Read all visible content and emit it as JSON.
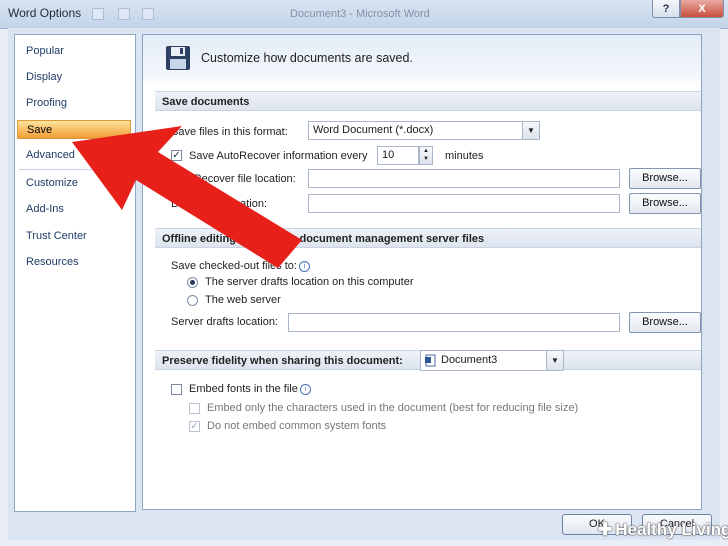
{
  "window": {
    "title": "Word Options",
    "background_title": "Document3 - Microsoft Word",
    "help_label": "?",
    "close_label": "X"
  },
  "sidebar": {
    "items": [
      {
        "label": "Popular"
      },
      {
        "label": "Display"
      },
      {
        "label": "Proofing"
      },
      {
        "label": "Save",
        "selected": true
      },
      {
        "label": "Advanced"
      },
      {
        "label": "Customize"
      },
      {
        "label": "Add-Ins"
      },
      {
        "label": "Trust Center"
      },
      {
        "label": "Resources"
      }
    ]
  },
  "header": {
    "text": "Customize how documents are saved."
  },
  "save_documents": {
    "title": "Save documents",
    "format_label": "Save files in this format:",
    "format_value": "Word Document (*.docx)",
    "autorecover_label": "Save AutoRecover information every",
    "autorecover_checked": true,
    "autorecover_minutes": "10",
    "minutes_label": "minutes",
    "autorecover_location_label": "AutoRecover file location:",
    "autorecover_location_value": "",
    "default_location_label": "Default file location:",
    "default_location_value": "",
    "browse_label": "Browse..."
  },
  "offline": {
    "title": "Offline editing options for document management server files",
    "save_checked_out_label": "Save checked-out files to:",
    "option_server_drafts": "The server drafts location on this computer",
    "option_web_server": "The web server",
    "server_drafts_label": "Server drafts location:",
    "server_drafts_value": "",
    "browse_label": "Browse..."
  },
  "fidelity": {
    "title": "Preserve fidelity when sharing this document:",
    "document_value": "Document3",
    "embed_fonts_label": "Embed fonts in the file",
    "embed_only_label": "Embed only the characters used in the document (best for reducing file size)",
    "no_common_label": "Do not embed common system fonts"
  },
  "footer": {
    "ok_label": "OK",
    "cancel_label": "Cancel"
  },
  "watermark": {
    "text": "Healthy Living"
  },
  "colors": {
    "annotation_arrow": "#e8201a",
    "selected_nav": "#f7b95e"
  }
}
